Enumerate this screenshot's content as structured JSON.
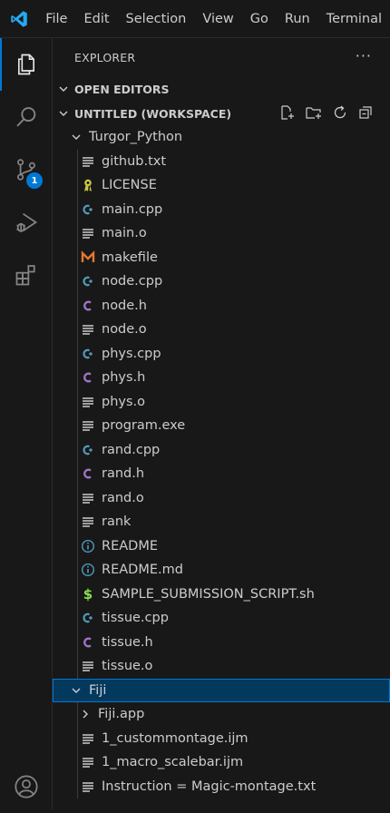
{
  "menu": [
    "File",
    "Edit",
    "Selection",
    "View",
    "Go",
    "Run",
    "Terminal"
  ],
  "activity": {
    "scm_badge": "1"
  },
  "explorer": {
    "title": "EXPLORER",
    "more": "···",
    "open_editors": "OPEN EDITORS",
    "workspace": "UNTITLED (WORKSPACE)"
  },
  "tree": [
    {
      "label": "Turgor_Python",
      "kind": "folder-open",
      "level": 1
    },
    {
      "label": "github.txt",
      "kind": "lines",
      "level": 2
    },
    {
      "label": "LICENSE",
      "kind": "license",
      "level": 2
    },
    {
      "label": "main.cpp",
      "kind": "cpp",
      "level": 2
    },
    {
      "label": "main.o",
      "kind": "lines",
      "level": 2
    },
    {
      "label": "makefile",
      "kind": "makefile",
      "level": 2
    },
    {
      "label": "node.cpp",
      "kind": "cpp",
      "level": 2
    },
    {
      "label": "node.h",
      "kind": "c",
      "level": 2
    },
    {
      "label": "node.o",
      "kind": "lines",
      "level": 2
    },
    {
      "label": "phys.cpp",
      "kind": "cpp",
      "level": 2
    },
    {
      "label": "phys.h",
      "kind": "c",
      "level": 2
    },
    {
      "label": "phys.o",
      "kind": "lines",
      "level": 2
    },
    {
      "label": "program.exe",
      "kind": "lines",
      "level": 2
    },
    {
      "label": "rand.cpp",
      "kind": "cpp",
      "level": 2
    },
    {
      "label": "rand.h",
      "kind": "c",
      "level": 2
    },
    {
      "label": "rand.o",
      "kind": "lines",
      "level": 2
    },
    {
      "label": "rank",
      "kind": "lines",
      "level": 2
    },
    {
      "label": "README",
      "kind": "info",
      "level": 2
    },
    {
      "label": "README.md",
      "kind": "info",
      "level": 2
    },
    {
      "label": "SAMPLE_SUBMISSION_SCRIPT.sh",
      "kind": "shell",
      "level": 2
    },
    {
      "label": "tissue.cpp",
      "kind": "cpp",
      "level": 2
    },
    {
      "label": "tissue.h",
      "kind": "c",
      "level": 2
    },
    {
      "label": "tissue.o",
      "kind": "lines",
      "level": 2
    },
    {
      "label": "Fiji",
      "kind": "folder-open",
      "level": 1,
      "selected": true
    },
    {
      "label": "Fiji.app",
      "kind": "folder-closed",
      "level": 2
    },
    {
      "label": "1_custommontage.ijm",
      "kind": "lines",
      "level": 2
    },
    {
      "label": "1_macro_scalebar.ijm",
      "kind": "lines",
      "level": 2
    },
    {
      "label": "Instruction = Magic-montage.txt",
      "kind": "lines",
      "level": 2
    }
  ],
  "colors": {
    "accent": "#0078d4",
    "selection": "#04395e",
    "background": "#181818"
  }
}
